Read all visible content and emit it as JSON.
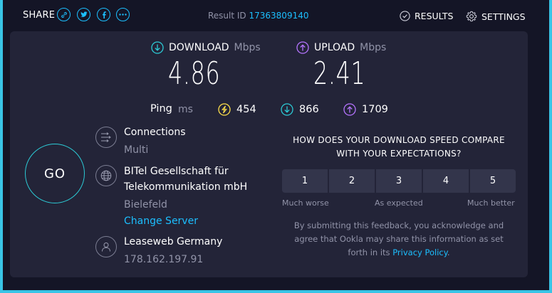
{
  "topbar": {
    "share_label": "SHARE",
    "share_icons": [
      "link-icon",
      "twitter-icon",
      "facebook-icon",
      "more-icon"
    ],
    "result_label": "Result ID",
    "result_id": "17363809140",
    "results_label": "RESULTS",
    "settings_label": "SETTINGS"
  },
  "download": {
    "label": "DOWNLOAD",
    "unit": "Mbps",
    "value": "4.86"
  },
  "upload": {
    "label": "UPLOAD",
    "unit": "Mbps",
    "value": "2.41"
  },
  "ping": {
    "label": "Ping",
    "unit": "ms",
    "idle": "454",
    "download": "866",
    "upload": "1709"
  },
  "go_label": "GO",
  "connections": {
    "title": "Connections",
    "value": "Multi"
  },
  "isp": {
    "name_line1": "BITel Gesellschaft für",
    "name_line2": "Telekommunikation mbH",
    "location": "Bielefeld",
    "change_server": "Change Server"
  },
  "host": {
    "name": "Leaseweb Germany",
    "ip": "178.162.197.91"
  },
  "feedback": {
    "question_line1": "HOW DOES YOUR DOWNLOAD SPEED COMPARE",
    "question_line2": "WITH YOUR EXPECTATIONS?",
    "ratings": [
      "1",
      "2",
      "3",
      "4",
      "5"
    ],
    "scale_low": "Much worse",
    "scale_mid": "As expected",
    "scale_high": "Much better",
    "disclaimer_line1": "By submitting this feedback, you acknowledge and",
    "disclaimer_line2": "agree that Ookla may share this information as set",
    "disclaimer_line3_prefix": "forth in its",
    "privacy_link": "Privacy Policy",
    "disclaimer_suffix": "."
  },
  "colors": {
    "accent": "#1cbfff",
    "download": "#2ccbd6",
    "upload": "#b574ff",
    "jitter": "#ffe04b",
    "panel": "#232438",
    "background": "#141526"
  }
}
